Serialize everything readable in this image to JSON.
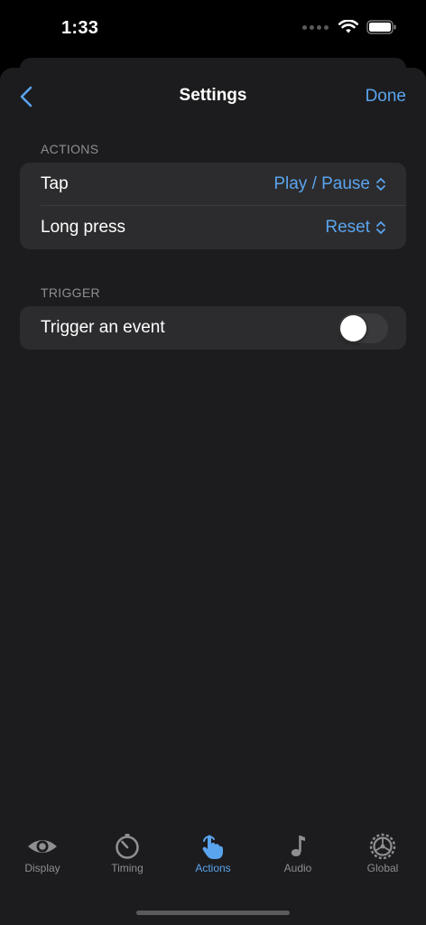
{
  "status_bar": {
    "time": "1:33"
  },
  "nav": {
    "title": "Settings",
    "done_label": "Done"
  },
  "sections": {
    "actions": {
      "header": "ACTIONS",
      "rows": [
        {
          "label": "Tap",
          "value": "Play / Pause"
        },
        {
          "label": "Long press",
          "value": "Reset"
        }
      ]
    },
    "trigger": {
      "header": "TRIGGER",
      "row": {
        "label": "Trigger an event",
        "toggle_on": false
      }
    }
  },
  "tabs": [
    {
      "label": "Display",
      "icon": "eye-icon"
    },
    {
      "label": "Timing",
      "icon": "stopwatch-icon"
    },
    {
      "label": "Actions",
      "icon": "hand-tap-icon",
      "active": true
    },
    {
      "label": "Audio",
      "icon": "music-note-icon"
    },
    {
      "label": "Global",
      "icon": "gear-icon"
    }
  ],
  "colors": {
    "background": "#000000",
    "sheet": "#1c1c1e",
    "card": "#2c2c2e",
    "accent": "#5aa4ee",
    "secondary_text": "#8e8e93"
  }
}
